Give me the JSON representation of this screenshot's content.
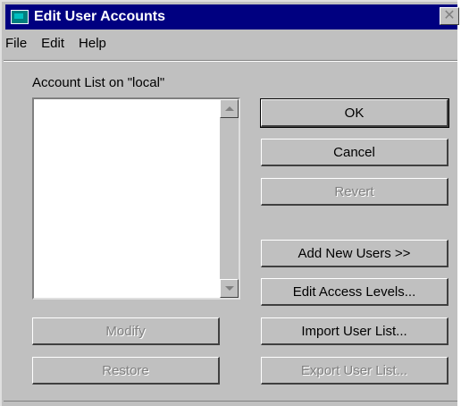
{
  "window": {
    "title": "Edit User Accounts",
    "close_glyph": "✕"
  },
  "menu": [
    {
      "label": "File"
    },
    {
      "label": "Edit"
    },
    {
      "label": "Help"
    }
  ],
  "account_list": {
    "label": "Account List on \"local\""
  },
  "buttons": {
    "ok": "OK",
    "cancel": "Cancel",
    "revert": "Revert",
    "add_new_users": "Add New Users >>",
    "edit_access_levels": "Edit Access Levels...",
    "modify": "Modify",
    "import_user_list": "Import User List...",
    "restore": "Restore",
    "export_user_list": "Export User List..."
  }
}
